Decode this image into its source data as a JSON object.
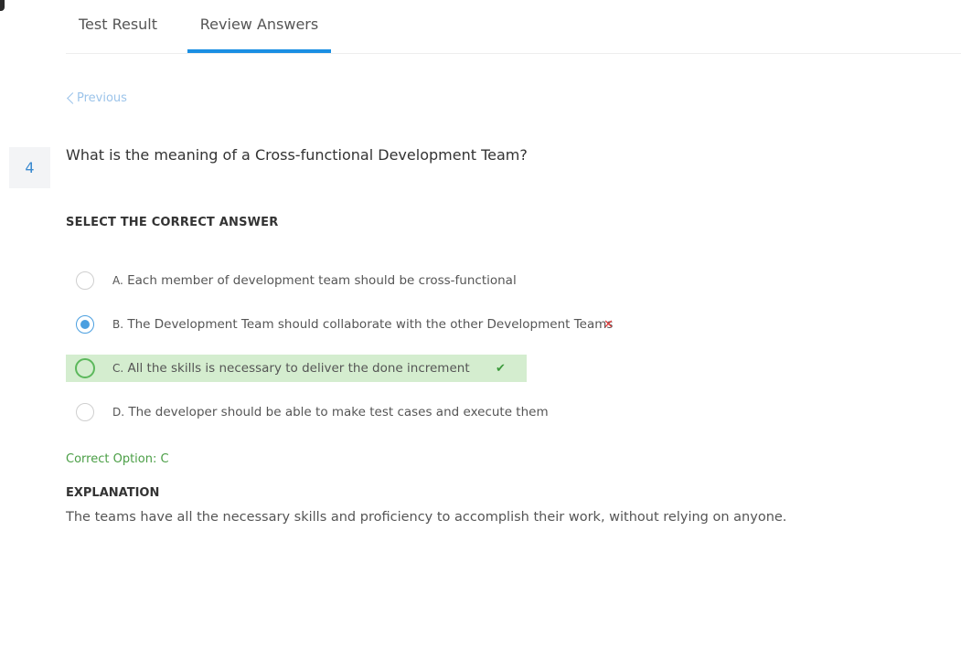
{
  "tabs": {
    "test_result": "Test Result",
    "review_answers": "Review Answers",
    "active": "review_answers"
  },
  "navigation": {
    "previous_label": "Previous"
  },
  "question": {
    "number": "4",
    "text": "What is the meaning of a Cross-functional Development Team?"
  },
  "answer_section": {
    "heading": "SELECT THE CORRECT ANSWER",
    "options": [
      {
        "letter": "A.",
        "text": "Each member of development team should be cross-functional",
        "selected": false,
        "correct": false
      },
      {
        "letter": "B.",
        "text": "The Development Team should collaborate with the other Development Teams",
        "selected": true,
        "correct": false
      },
      {
        "letter": "C.",
        "text": "All the skills is necessary to deliver the done increment",
        "selected": false,
        "correct": true
      },
      {
        "letter": "D.",
        "text": "The developer should be able to make test cases and execute them",
        "selected": false,
        "correct": false
      }
    ],
    "wrong_mark": "✕",
    "check_mark": "✔"
  },
  "result": {
    "correct_option": "Correct Option: C"
  },
  "explanation": {
    "heading": "EXPLANATION",
    "text": "The teams have all the necessary skills and proficiency to accomplish their work, without relying on anyone."
  },
  "colors": {
    "accent": "#1a8fe3",
    "correct_bg": "#d4edcf",
    "correct_text": "#4a9e45",
    "wrong": "#e03b3b"
  }
}
